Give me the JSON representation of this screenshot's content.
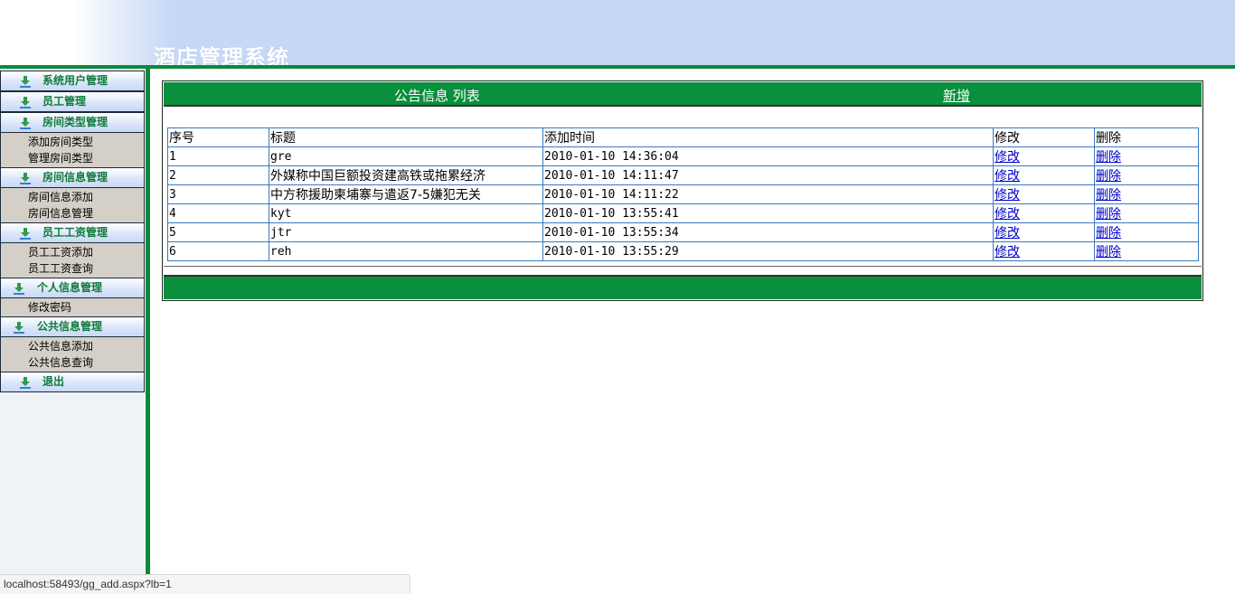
{
  "header": {
    "title": "酒店管理系统"
  },
  "sidebar": {
    "menus": [
      {
        "label": "系统用户管理",
        "items": []
      },
      {
        "label": "员工管理",
        "items": []
      },
      {
        "label": "房间类型管理",
        "items": [
          "添加房间类型",
          "管理房间类型"
        ]
      },
      {
        "label": "房间信息管理",
        "items": [
          "房间信息添加",
          "房间信息管理"
        ]
      },
      {
        "label": "员工工资管理",
        "items": [
          "员工工资添加",
          "员工工资查询"
        ]
      },
      {
        "label": "个人信息管理",
        "items": [
          "修改密码"
        ]
      },
      {
        "label": "公共信息管理",
        "items": [
          "公共信息添加",
          "公共信息查询"
        ]
      },
      {
        "label": "退出",
        "items": []
      }
    ]
  },
  "panel": {
    "title": "公告信息 列表",
    "add_label": "新增",
    "columns": [
      "序号",
      "标题",
      "添加时间",
      "修改",
      "删除"
    ],
    "rows": [
      {
        "id": "1",
        "title": "gre",
        "time": "2010-01-10 14:36:04",
        "edit": "修改",
        "delete": "删除"
      },
      {
        "id": "2",
        "title": "外媒称中国巨额投资建高铁或拖累经济",
        "time": "2010-01-10 14:11:47",
        "edit": "修改",
        "delete": "删除"
      },
      {
        "id": "3",
        "title": "中方称援助柬埔寨与遣返7-5嫌犯无关",
        "time": "2010-01-10 14:11:22",
        "edit": "修改",
        "delete": "删除"
      },
      {
        "id": "4",
        "title": "kyt",
        "time": "2010-01-10 13:55:41",
        "edit": "修改",
        "delete": "删除"
      },
      {
        "id": "5",
        "title": "jtr",
        "time": "2010-01-10 13:55:34",
        "edit": "修改",
        "delete": "删除"
      },
      {
        "id": "6",
        "title": "reh",
        "time": "2010-01-10 13:55:29",
        "edit": "修改",
        "delete": "删除"
      }
    ]
  },
  "statusbar": {
    "url": "localhost:58493/gg_add.aspx?lb=1"
  },
  "colors": {
    "green": "#0a8f3c",
    "header_blue": "#c4d6f3",
    "link": "#0000cc",
    "menu_text": "#0f7b3a"
  }
}
